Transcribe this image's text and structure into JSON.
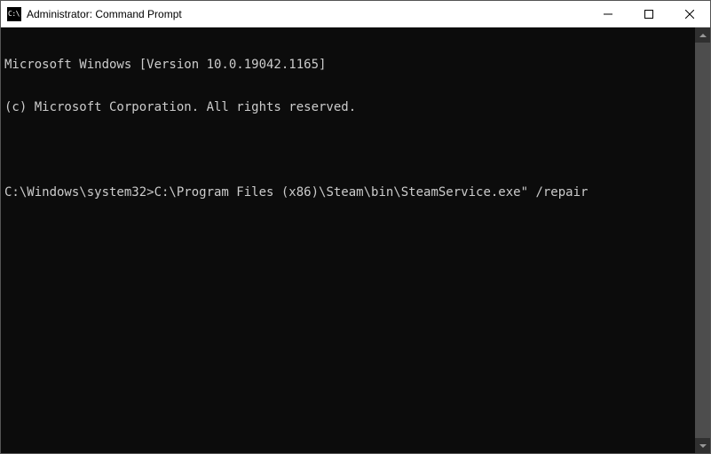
{
  "titlebar": {
    "icon_label": "C:\\.",
    "title": "Administrator: Command Prompt"
  },
  "terminal": {
    "line1": "Microsoft Windows [Version 10.0.19042.1165]",
    "line2": "(c) Microsoft Corporation. All rights reserved.",
    "blank": "",
    "prompt": "C:\\Windows\\system32>",
    "command": "C:\\Program Files (x86)\\Steam\\bin\\SteamService.exe\" /repair"
  }
}
